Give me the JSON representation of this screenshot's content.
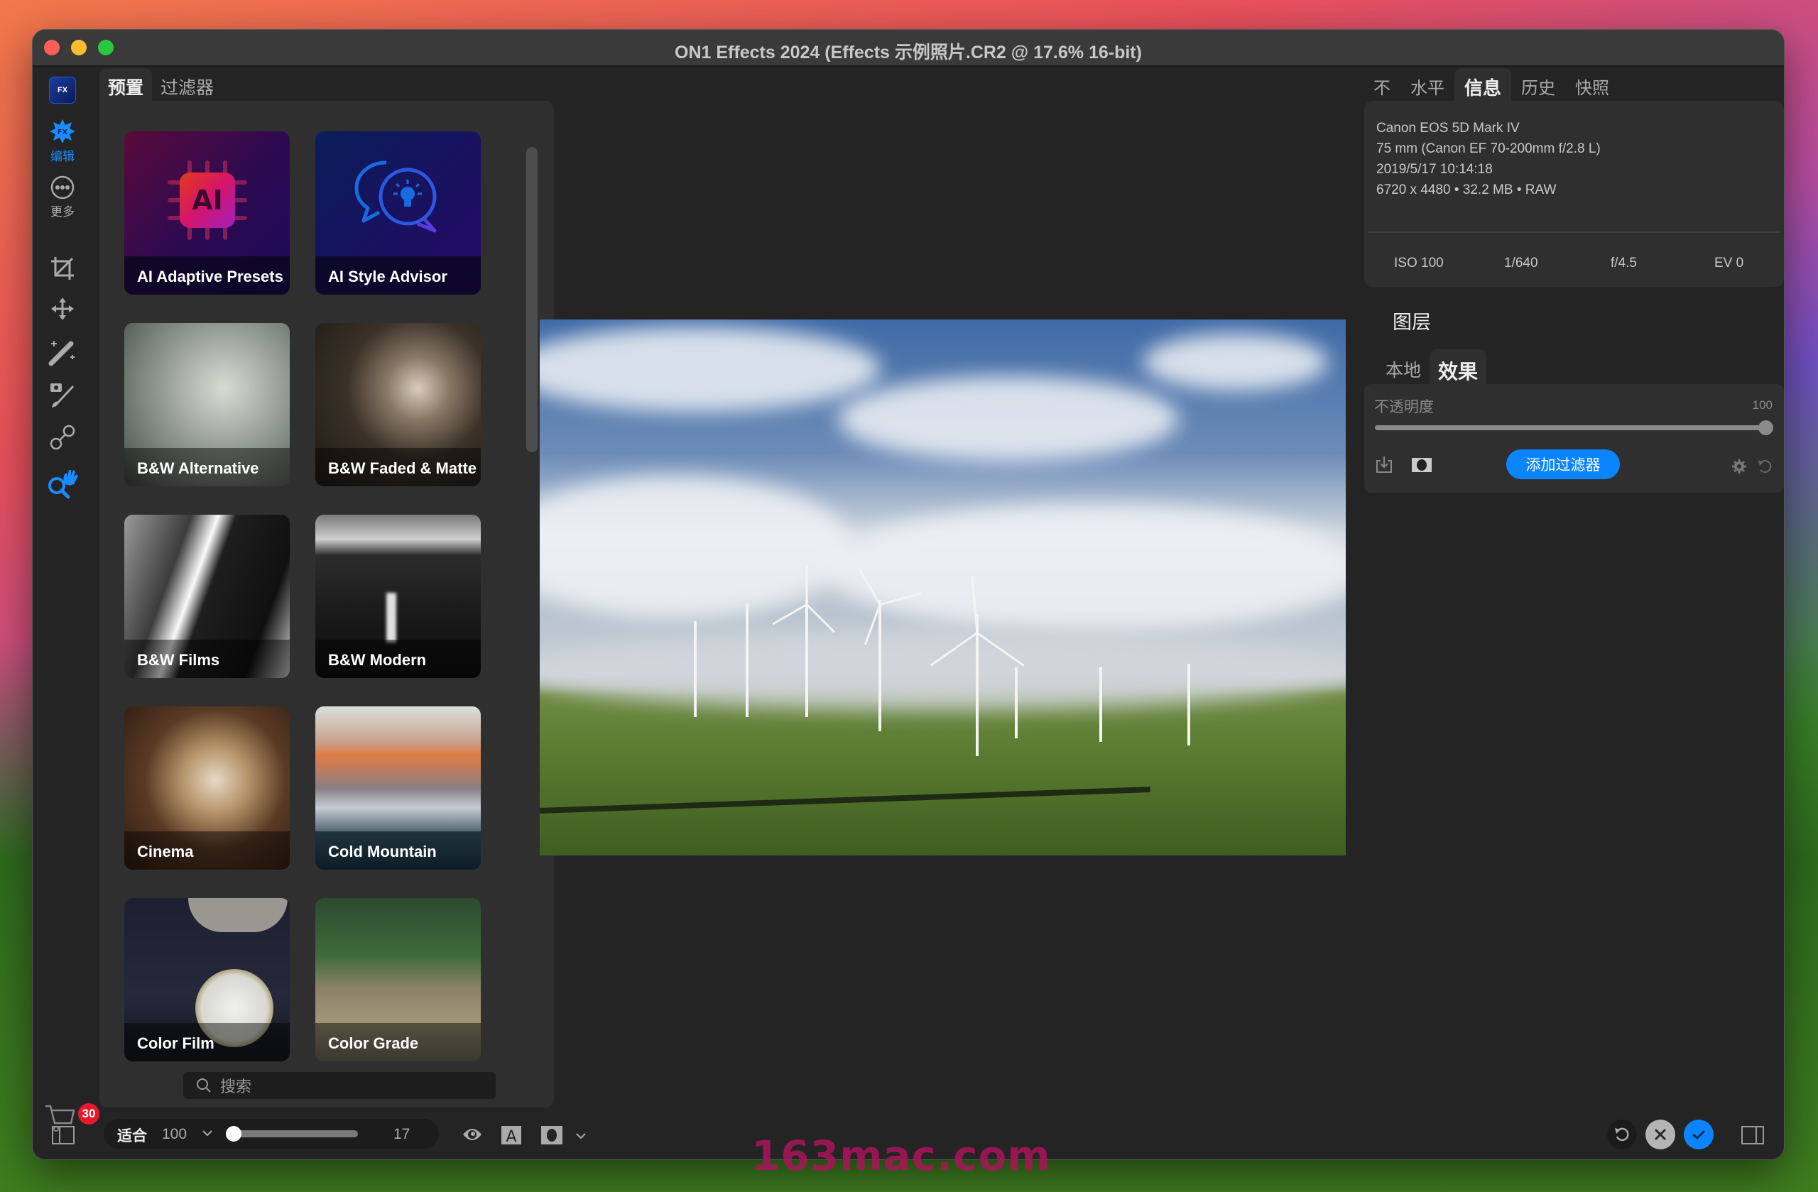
{
  "window": {
    "title": "ON1 Effects 2024 (Effects 示例照片.CR2 @ 17.6% 16-bit)"
  },
  "rail": {
    "logo_text": "FX",
    "items": [
      {
        "name": "edit",
        "label": "编辑",
        "icon": "fx-star-icon",
        "active": true
      },
      {
        "name": "more",
        "label": "更多",
        "icon": "more-icon",
        "active": false
      }
    ],
    "tools": [
      "crop-icon",
      "move-icon",
      "magic-wand-icon",
      "brush-icon",
      "retouch-icon",
      "zoom-pan-icon"
    ],
    "cart_badge": "30"
  },
  "preset_panel": {
    "tabs": [
      {
        "label": "预置",
        "active": true
      },
      {
        "label": "过滤器",
        "active": false
      }
    ],
    "presets": [
      {
        "label": "AI Adaptive Presets"
      },
      {
        "label": "AI Style Advisor"
      },
      {
        "label": "B&W Alternative"
      },
      {
        "label": "B&W Faded & Matte"
      },
      {
        "label": "B&W Films"
      },
      {
        "label": "B&W Modern"
      },
      {
        "label": "Cinema"
      },
      {
        "label": "Cold Mountain"
      },
      {
        "label": "Color Film"
      },
      {
        "label": "Color Grade"
      }
    ],
    "search_placeholder": "搜索"
  },
  "right_panel": {
    "tabs": [
      {
        "label": "不",
        "active": false
      },
      {
        "label": "水平",
        "active": false
      },
      {
        "label": "信息",
        "active": true
      },
      {
        "label": "历史",
        "active": false
      },
      {
        "label": "快照",
        "active": false
      }
    ],
    "info": {
      "camera": "Canon EOS 5D Mark IV",
      "lens": "75 mm (Canon EF 70-200mm f/2.8 L)",
      "datetime": "2019/5/17  10:14:18",
      "file": "6720 x 4480  •  32.2 MB  •  RAW",
      "iso": "ISO 100",
      "shutter": "1/640",
      "aperture": "f/4.5",
      "ev": "EV 0"
    },
    "layers": {
      "title": "图层",
      "tabs": [
        {
          "label": "本地",
          "active": false
        },
        {
          "label": "效果",
          "active": true
        }
      ],
      "opacity_label": "不透明度",
      "opacity_value": "100",
      "opacity_fraction": 1.0,
      "add_filter_label": "添加过滤器"
    }
  },
  "bottom_bar": {
    "fit_label": "适合",
    "zoom_value": "100",
    "zoom_slider_fraction": 0.0,
    "zoom_readout": "17"
  },
  "colors": {
    "accent": "#0a84ff",
    "badge": "#e8192c",
    "panel_bg": "#2f2f2f",
    "window_bg": "#242424"
  },
  "watermark": "163mac.com"
}
